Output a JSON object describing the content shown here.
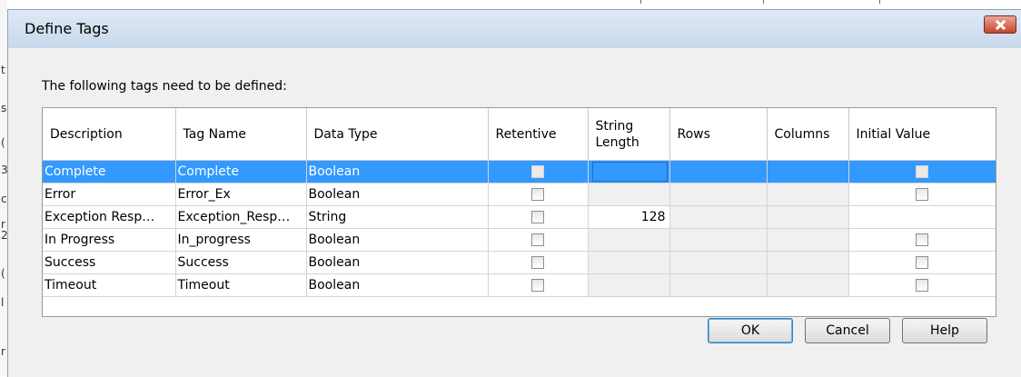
{
  "window": {
    "title": "Define Tags",
    "prompt": "The following tags need to be defined:"
  },
  "grid": {
    "columns": [
      "Description",
      "Tag Name",
      "Data Type",
      "Retentive",
      "String Length",
      "Rows",
      "Columns",
      "Initial Value"
    ],
    "rows": [
      {
        "description": "Complete",
        "tag_name": "Complete",
        "data_type": "Boolean",
        "retentive": false,
        "string_length": "",
        "initial_value": false,
        "selected": true
      },
      {
        "description": "Error",
        "tag_name": "Error_Ex",
        "data_type": "Boolean",
        "retentive": false,
        "string_length": "",
        "initial_value": false,
        "selected": false
      },
      {
        "description": "Exception Resp…",
        "tag_name": "Exception_Resp…",
        "data_type": "String",
        "retentive": false,
        "string_length": "128",
        "initial_value": null,
        "selected": false
      },
      {
        "description": "In Progress",
        "tag_name": "In_progress",
        "data_type": "Boolean",
        "retentive": false,
        "string_length": "",
        "initial_value": false,
        "selected": false
      },
      {
        "description": "Success",
        "tag_name": "Success",
        "data_type": "Boolean",
        "retentive": false,
        "string_length": "",
        "initial_value": false,
        "selected": false
      },
      {
        "description": "Timeout",
        "tag_name": "Timeout",
        "data_type": "Boolean",
        "retentive": false,
        "string_length": "",
        "initial_value": false,
        "selected": false
      }
    ]
  },
  "buttons": {
    "ok": "OK",
    "cancel": "Cancel",
    "help": "Help"
  },
  "background": {
    "fragments": [
      "t",
      "s",
      "(",
      "3",
      "c",
      "r",
      "2",
      "(",
      "l",
      "r"
    ]
  },
  "colors": {
    "selection": "#3399ff",
    "close_button": "#c5442c",
    "titlebar": "#c8d8ec"
  }
}
